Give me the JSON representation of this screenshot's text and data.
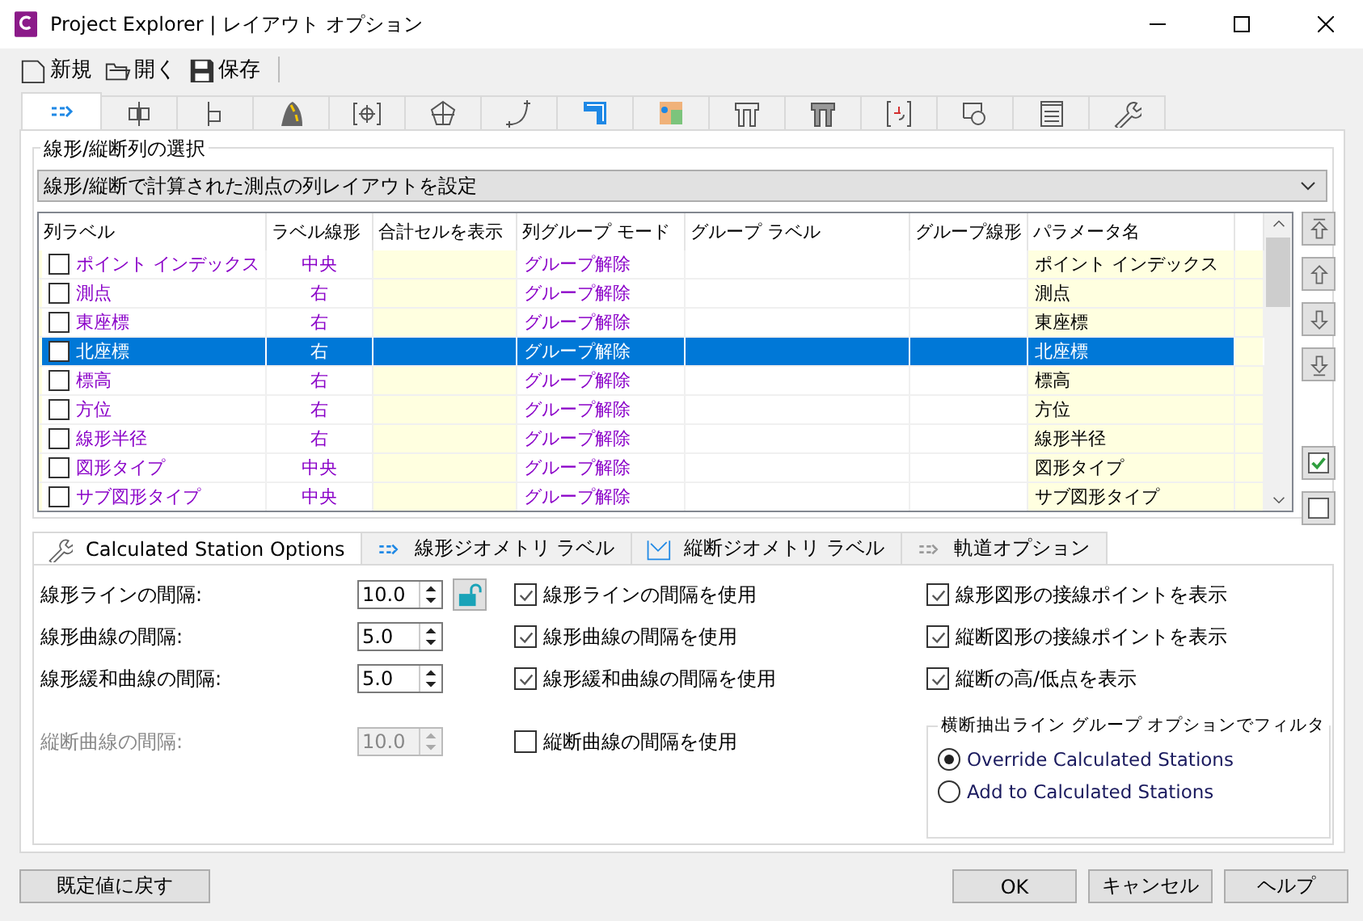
{
  "window": {
    "title": "Project Explorer | レイアウト オプション"
  },
  "toolbar": [
    {
      "kind": "new",
      "label": "新規"
    },
    {
      "kind": "open",
      "label": "開く"
    },
    {
      "kind": "save",
      "label": "保存"
    }
  ],
  "layout_tabs": [
    {
      "selected": true
    },
    {
      "selected": false
    },
    {
      "selected": false
    },
    {
      "selected": false
    },
    {
      "selected": false
    },
    {
      "selected": false
    },
    {
      "selected": false
    },
    {
      "selected": false
    },
    {
      "selected": false
    },
    {
      "selected": false
    },
    {
      "selected": false
    },
    {
      "selected": false
    },
    {
      "selected": false
    },
    {
      "selected": false
    },
    {
      "selected": false
    }
  ],
  "column_selection": {
    "title": "線形/縦断列の選択",
    "dropdown": "線形/縦断で計算された測点の列レイアウトを設定"
  },
  "table": {
    "columns": [
      "列ラベル",
      "ラベル線形",
      "合計セルを表示",
      "列グループ モード",
      "グループ ラベル",
      "グループ線形",
      "パラメータ名"
    ],
    "rows": [
      {
        "checked": false,
        "selected": false,
        "label": "ポイント インデックス",
        "alignment": "中央",
        "group_mode": "グループ解除",
        "parameter": "ポイント インデックス"
      },
      {
        "checked": false,
        "selected": false,
        "label": "測点",
        "alignment": "右",
        "group_mode": "グループ解除",
        "parameter": "測点"
      },
      {
        "checked": false,
        "selected": false,
        "label": "東座標",
        "alignment": "右",
        "group_mode": "グループ解除",
        "parameter": "東座標"
      },
      {
        "checked": false,
        "selected": true,
        "label": "北座標",
        "alignment": "右",
        "group_mode": "グループ解除",
        "parameter": "北座標"
      },
      {
        "checked": false,
        "selected": false,
        "label": "標高",
        "alignment": "右",
        "group_mode": "グループ解除",
        "parameter": "標高"
      },
      {
        "checked": false,
        "selected": false,
        "label": "方位",
        "alignment": "右",
        "group_mode": "グループ解除",
        "parameter": "方位"
      },
      {
        "checked": false,
        "selected": false,
        "label": "線形半径",
        "alignment": "右",
        "group_mode": "グループ解除",
        "parameter": "線形半径"
      },
      {
        "checked": false,
        "selected": false,
        "label": "図形タイプ",
        "alignment": "中央",
        "group_mode": "グループ解除",
        "parameter": "図形タイプ"
      },
      {
        "checked": false,
        "selected": false,
        "label": "サブ図形タイプ",
        "alignment": "中央",
        "group_mode": "グループ解除",
        "parameter": "サブ図形タイプ"
      }
    ]
  },
  "option_tabs": [
    {
      "label": "Calculated Station Options",
      "selected": true
    },
    {
      "label": "線形ジオメトリ ラベル",
      "selected": false
    },
    {
      "label": "縦断ジオメトリ ラベル",
      "selected": false
    },
    {
      "label": "軌道オプション",
      "selected": false
    }
  ],
  "intervals": [
    {
      "label": "線形ラインの間隔:",
      "value": "10.0",
      "disabled": false,
      "locked": false
    },
    {
      "label": "線形曲線の間隔:",
      "value": "5.0",
      "disabled": false
    },
    {
      "label": "線形緩和曲線の間隔:",
      "value": "5.0",
      "disabled": false
    },
    {
      "label": "縦断曲線の間隔:",
      "value": "10.0",
      "disabled": true
    }
  ],
  "use_checkboxes": [
    {
      "label": "線形ラインの間隔を使用",
      "checked": true
    },
    {
      "label": "線形曲線の間隔を使用",
      "checked": true
    },
    {
      "label": "線形緩和曲線の間隔を使用",
      "checked": true
    },
    {
      "label": "縦断曲線の間隔を使用",
      "checked": false
    }
  ],
  "display_checkboxes": [
    {
      "label": "線形図形の接線ポイントを表示",
      "checked": true
    },
    {
      "label": "縦断図形の接線ポイントを表示",
      "checked": true
    },
    {
      "label": "縦断の高/低点を表示",
      "checked": true
    }
  ],
  "filter_group": {
    "title": "横断抽出ライン グループ オプションでフィルタ",
    "options": [
      {
        "label": "Override Calculated Stations",
        "selected": true
      },
      {
        "label": "Add to Calculated Stations",
        "selected": false
      }
    ]
  },
  "buttons": {
    "reset": "既定値に戻す",
    "actions": [
      "OK",
      "キャンセル",
      "ヘルプ"
    ]
  }
}
